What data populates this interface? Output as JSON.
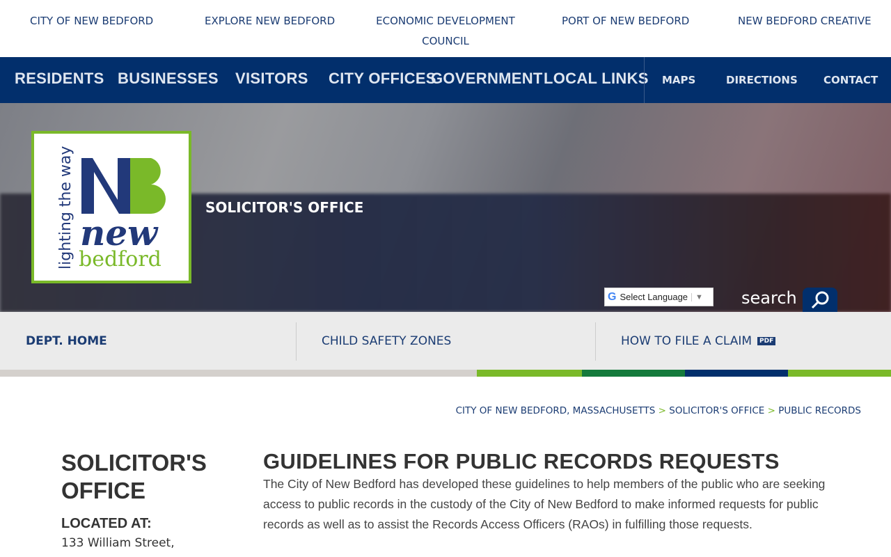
{
  "top_links": [
    "CITY OF NEW BEDFORD",
    "EXPLORE NEW BEDFORD",
    "ECONOMIC DEVELOPMENT COUNCIL",
    "PORT OF NEW BEDFORD",
    "NEW BEDFORD CREATIVE"
  ],
  "main_nav": [
    "RESIDENTS",
    "BUSINESSES",
    "VISITORS",
    "CITY OFFICES",
    "GOVERNMENT",
    "LOCAL LINKS"
  ],
  "secondary_nav": [
    "MAPS",
    "DIRECTIONS",
    "CONTACT"
  ],
  "logo": {
    "tagline": "lighting the way",
    "name1": "new",
    "name2": "bedford",
    "mark": "NB"
  },
  "hero": {
    "title": "SOLICITOR'S OFFICE",
    "language": "Select Language",
    "search_label": "search"
  },
  "subnav": {
    "items": [
      "DEPT. HOME",
      "CHILD SAFETY ZONES",
      "HOW TO FILE A CLAIM"
    ],
    "pdf_badge": "PDF"
  },
  "color_bar": [
    "#d4d0cc",
    "#7ab929",
    "#157a3c",
    "#022f6c",
    "#7ab929"
  ],
  "breadcrumb": [
    "CITY OF NEW BEDFORD, MASSACHUSETTS",
    "SOLICITOR'S OFFICE",
    "PUBLIC RECORDS"
  ],
  "sidebar": {
    "title": "SOLICITOR'S OFFICE",
    "located_label": "LOCATED AT:",
    "address": "133 William Street,"
  },
  "content": {
    "heading": "GUIDELINES FOR PUBLIC RECORDS REQUESTS",
    "body": "The City of New Bedford has developed these guidelines to help members of the public who are seeking access to public records in the custody of the City of New Bedford to make informed requests for public records as well as to assist the Records Access Officers (RAOs) in fulfilling those requests."
  }
}
